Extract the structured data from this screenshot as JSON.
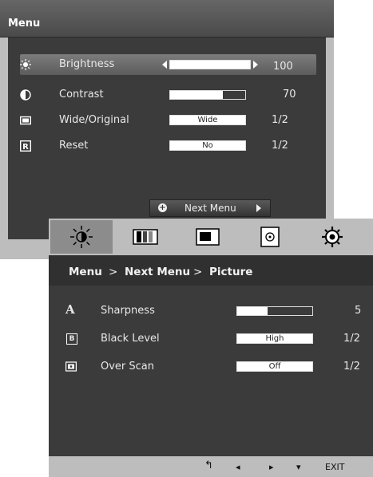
{
  "menu": {
    "title": "Menu",
    "items": [
      {
        "label": "Brightness",
        "value": "100",
        "level": 1.0,
        "icon": "sun-icon"
      },
      {
        "label": "Contrast",
        "value": "70",
        "level": 0.7,
        "icon": "contrast-icon"
      },
      {
        "label": "Wide/Original",
        "value": "1/2",
        "option": "Wide",
        "icon": "wide-icon"
      },
      {
        "label": "Reset",
        "value": "1/2",
        "option": "No",
        "icon": "reset-icon"
      }
    ],
    "next_menu_label": "Next Menu"
  },
  "submenu": {
    "tabs": [
      "picture-tab",
      "color-tab",
      "display-tab",
      "audio-tab",
      "other-tab"
    ],
    "breadcrumb": [
      "Menu",
      ">",
      "Next Menu",
      ">",
      "Picture"
    ],
    "items": [
      {
        "label": "Sharpness",
        "value": "5",
        "level": 0.5,
        "icon": "A"
      },
      {
        "label": "Black Level",
        "value": "1/2",
        "option": "High",
        "icon": "B"
      },
      {
        "label": "Over Scan",
        "value": "1/2",
        "option": "Off",
        "icon": "over-scan-icon"
      }
    ],
    "footer": {
      "back": "↰",
      "left": "◂",
      "right": "▸",
      "down": "▾",
      "exit": "EXIT"
    }
  }
}
